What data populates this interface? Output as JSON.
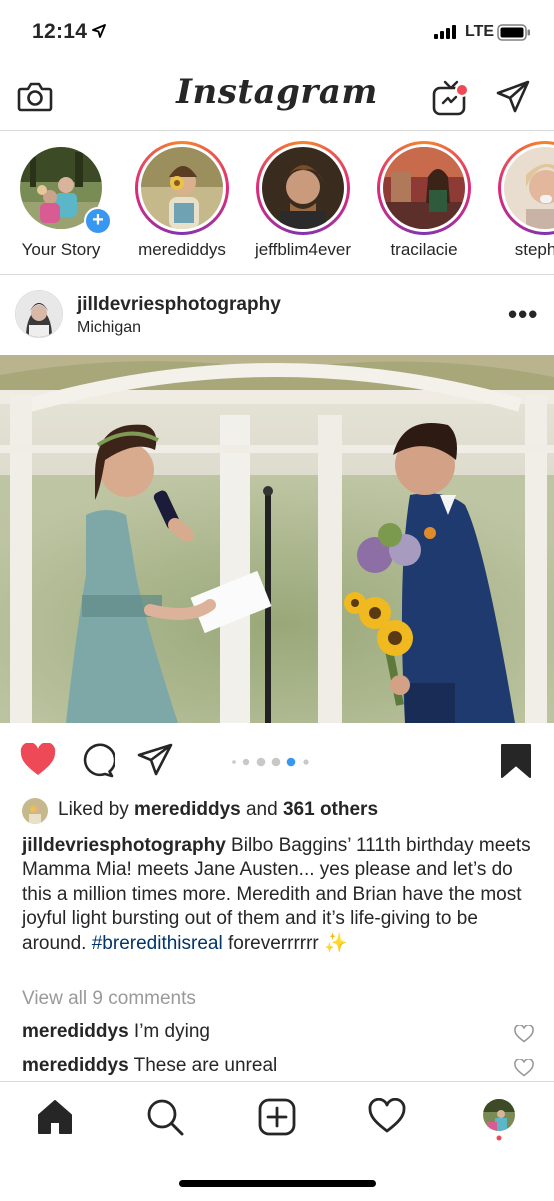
{
  "status": {
    "time": "12:14",
    "carrier": "LTE"
  },
  "header": {
    "logo": "Instagram"
  },
  "stories": [
    {
      "name": "Your Story",
      "own": true
    },
    {
      "name": "merediddys",
      "own": false
    },
    {
      "name": "jeffblim4ever",
      "own": false
    },
    {
      "name": "tracilacie",
      "own": false
    },
    {
      "name": "stephan",
      "own": false
    }
  ],
  "post": {
    "username": "jilldevriesphotography",
    "location": "Michigan",
    "likes_prefix": "Liked by ",
    "likes_user": "merediddys",
    "likes_and": " and ",
    "likes_count": "361 others",
    "caption_user": "jilldevriesphotography",
    "caption_text": " Bilbo Baggins’ 111th birthday meets Mamma Mia! meets Jane Austen... yes please and let’s do this a million times more. Meredith and Brian have the most joyful light bursting out of them and it’s life-giving to be around. ",
    "caption_tag": "#breredithisreal",
    "caption_end": " foreverrrrrr ✨",
    "view_all": "View all 9 comments",
    "carousel": {
      "count": 6,
      "active": 4
    },
    "comments": [
      {
        "user": "merediddys",
        "text": " I’m dying"
      },
      {
        "user": "merediddys",
        "text": " These are unreal"
      }
    ]
  },
  "colors": {
    "like": "#ed4956",
    "link": "#003569",
    "dot_active": "#3897f0",
    "story_plus": "#3897f0"
  },
  "icons": [
    "camera-icon",
    "igtv-icon",
    "direct-icon",
    "heart-icon",
    "comment-icon",
    "share-icon",
    "bookmark-icon",
    "home-icon",
    "search-icon",
    "add-icon",
    "activity-icon",
    "profile-icon"
  ]
}
